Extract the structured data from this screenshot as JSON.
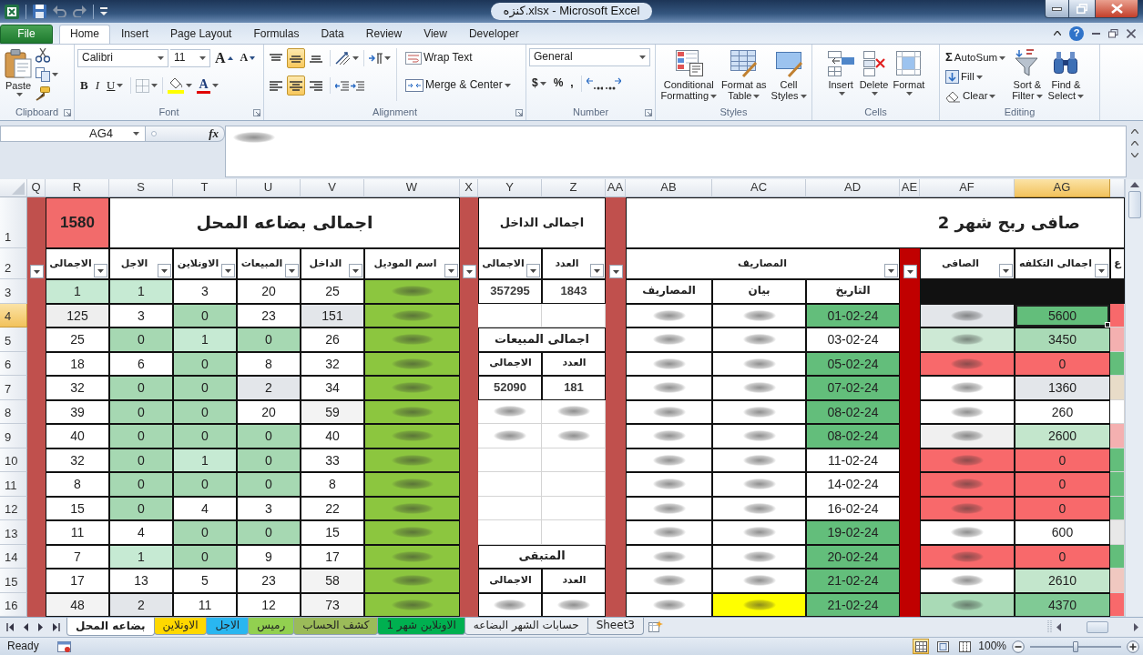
{
  "window": {
    "title": "كنزه.xlsx - Microsoft Excel"
  },
  "ribbon_tabs": [
    {
      "label": "Developer",
      "kind": "tab",
      "selected": false
    },
    {
      "label": "View",
      "kind": "tab",
      "selected": false
    },
    {
      "label": "Review",
      "kind": "tab",
      "selected": false
    },
    {
      "label": "Data",
      "kind": "tab",
      "selected": false
    },
    {
      "label": "Formulas",
      "kind": "tab",
      "selected": false
    },
    {
      "label": "Page Layout",
      "kind": "tab",
      "selected": false
    },
    {
      "label": "Insert",
      "kind": "tab",
      "selected": false
    },
    {
      "label": "Home",
      "kind": "tab",
      "selected": true
    },
    {
      "label": "File",
      "kind": "file",
      "selected": false
    }
  ],
  "help": "?",
  "ribbon": {
    "clipboard": {
      "label": "Clipboard",
      "paste": "Paste"
    },
    "font": {
      "label": "Font",
      "font_name": "Calibri",
      "font_size": "11",
      "grow": "A",
      "shrink": "A",
      "bold": "B",
      "italic": "I",
      "underline": "U",
      "font_color": "A"
    },
    "alignment": {
      "label": "Alignment",
      "vertical": [
        {
          "kind": "bottom",
          "selected": false
        },
        {
          "kind": "middle",
          "selected": true
        },
        {
          "kind": "top",
          "selected": false
        }
      ],
      "horizontal": [
        {
          "kind": "right",
          "selected": false
        },
        {
          "kind": "center",
          "selected": true
        },
        {
          "kind": "left",
          "selected": false
        }
      ],
      "wrap_text": "Wrap Text",
      "merge_center": "Merge & Center"
    },
    "number": {
      "label": "Number",
      "format": "General",
      "currency": "$",
      "percent": "%",
      "comma": ","
    },
    "styles": {
      "label": "Styles",
      "buttons": [
        {
          "kind": "cell_styles",
          "lines": [
            "Cell",
            "Styles"
          ]
        },
        {
          "kind": "table",
          "lines": [
            "Format as",
            "Table"
          ]
        },
        {
          "kind": "conditional",
          "lines": [
            "Conditional",
            "Formatting"
          ]
        }
      ]
    },
    "cells": {
      "label": "Cells",
      "buttons": [
        {
          "kind": "format",
          "label": "Format"
        },
        {
          "kind": "delete",
          "label": "Delete"
        },
        {
          "kind": "insert",
          "label": "Insert"
        }
      ]
    },
    "editing": {
      "label": "Editing",
      "small": [
        {
          "kind": "autosum",
          "symbol": "Σ",
          "label": "AutoSum"
        },
        {
          "kind": "fill",
          "label": "Fill"
        },
        {
          "kind": "clear",
          "label": "Clear"
        }
      ],
      "large": [
        {
          "kind": "find",
          "lines": [
            "Find &",
            "Select"
          ]
        },
        {
          "kind": "sort",
          "lines": [
            "Sort &",
            "Filter"
          ]
        }
      ]
    }
  },
  "formula_bar": {
    "name_box": "AG4",
    "fx": "fx",
    "formula_blurred": true
  },
  "sheet": {
    "columns": [
      {
        "label": "AG",
        "selected": true
      },
      {
        "label": "AF",
        "selected": false
      },
      {
        "label": "AE",
        "selected": false
      },
      {
        "label": "AD",
        "selected": false
      },
      {
        "label": "AC",
        "selected": false
      },
      {
        "label": "AB",
        "selected": false
      },
      {
        "label": "AA",
        "selected": false
      },
      {
        "label": "Z",
        "selected": false
      },
      {
        "label": "Y",
        "selected": false
      },
      {
        "label": "X",
        "selected": false
      },
      {
        "label": "W",
        "selected": false
      },
      {
        "label": "V",
        "selected": false
      },
      {
        "label": "U",
        "selected": false
      },
      {
        "label": "T",
        "selected": false
      },
      {
        "label": "S",
        "selected": false
      },
      {
        "label": "R",
        "selected": false
      },
      {
        "label": "Q",
        "selected": false
      }
    ],
    "rows": [
      {
        "label": "1",
        "selected": false
      },
      {
        "label": "2",
        "selected": false
      },
      {
        "label": "3",
        "selected": false
      },
      {
        "label": "4",
        "selected": true
      },
      {
        "label": "5",
        "selected": false
      },
      {
        "label": "6",
        "selected": false
      },
      {
        "label": "7",
        "selected": false
      },
      {
        "label": "8",
        "selected": false
      },
      {
        "label": "9",
        "selected": false
      },
      {
        "label": "10",
        "selected": false
      },
      {
        "label": "11",
        "selected": false
      },
      {
        "label": "12",
        "selected": false
      },
      {
        "label": "13",
        "selected": false
      },
      {
        "label": "14",
        "selected": false
      },
      {
        "label": "15",
        "selected": false
      },
      {
        "label": "16",
        "selected": false
      }
    ],
    "profit": {
      "title": "صافى ربح شهر 2",
      "cut_header": "ع",
      "cost_header": "اجمالى التكلفه",
      "net_header": "الصافى",
      "expenses_group": "المصاريف",
      "sub_headers": [
        "التاريخ",
        "بيان",
        "المصاريف"
      ],
      "rows": [
        {
          "edge": {
            "color": "#f8696b"
          },
          "cost": {
            "text": "5600",
            "color": "#63be7b"
          },
          "net": {
            "blurred": true,
            "color": "#e3e6ea"
          },
          "date": {
            "text": "01-02-24",
            "color": "#63be7b"
          },
          "note": {
            "blurred": true
          },
          "amount": {
            "blurred": true
          }
        },
        {
          "edge": {
            "color": "#f4b0b0"
          },
          "cost": {
            "text": "3450",
            "color": "#a9dab6"
          },
          "net": {
            "blurred": true,
            "color": "#cde9d5"
          },
          "date": {
            "text": "03-02-24"
          },
          "note": {
            "blurred": true
          },
          "amount": {
            "blurred": true
          }
        },
        {
          "edge": {
            "color": "#63be7b"
          },
          "cost": {
            "text": "0",
            "color": "#f8696b"
          },
          "net": {
            "blurred": true,
            "color": "#f8696b"
          },
          "date": {
            "text": "05-02-24",
            "color": "#63be7b"
          },
          "note": {
            "blurred": true
          },
          "amount": {
            "blurred": true
          }
        },
        {
          "edge": {
            "color": "#e8dcc8"
          },
          "cost": {
            "text": "1360",
            "color": "#e3e6ea"
          },
          "net": {
            "blurred": true
          },
          "date": {
            "text": "07-02-24",
            "color": "#63be7b"
          },
          "note": {
            "blurred": true
          },
          "amount": {
            "blurred": true
          }
        },
        {
          "cost": {
            "text": "260"
          },
          "net": {
            "blurred": true
          },
          "date": {
            "text": "08-02-24",
            "color": "#63be7b"
          },
          "note": {
            "blurred": true
          },
          "amount": {
            "blurred": true
          }
        },
        {
          "edge": {
            "color": "#f4b0b0"
          },
          "cost": {
            "text": "2600",
            "color": "#c3e6cc"
          },
          "net": {
            "blurred": true,
            "color": "#f0f0f0"
          },
          "date": {
            "text": "08-02-24",
            "color": "#63be7b"
          },
          "note": {
            "blurred": true
          },
          "amount": {
            "blurred": true
          }
        },
        {
          "edge": {
            "color": "#63be7b"
          },
          "cost": {
            "text": "0",
            "color": "#f8696b"
          },
          "net": {
            "blurred": true,
            "color": "#f8696b"
          },
          "date": {
            "text": "11-02-24"
          },
          "note": {
            "blurred": true
          },
          "amount": {
            "blurred": true
          }
        },
        {
          "edge": {
            "color": "#63be7b"
          },
          "cost": {
            "text": "0",
            "color": "#f8696b"
          },
          "net": {
            "blurred": true,
            "color": "#f8696b"
          },
          "date": {
            "text": "14-02-24"
          },
          "note": {
            "blurred": true
          },
          "amount": {
            "blurred": true
          }
        },
        {
          "edge": {
            "color": "#63be7b"
          },
          "cost": {
            "text": "0",
            "color": "#f8696b"
          },
          "net": {
            "blurred": true,
            "color": "#f8696b"
          },
          "date": {
            "text": "16-02-24"
          },
          "note": {
            "blurred": true
          },
          "amount": {
            "blurred": true
          }
        },
        {
          "edge": {
            "color": "#e8e8e8"
          },
          "cost": {
            "text": "600"
          },
          "net": {
            "blurred": true
          },
          "date": {
            "text": "19-02-24",
            "color": "#63be7b"
          },
          "note": {
            "blurred": true
          },
          "amount": {
            "blurred": true
          }
        },
        {
          "edge": {
            "color": "#63be7b"
          },
          "cost": {
            "text": "0",
            "color": "#f8696b"
          },
          "net": {
            "blurred": true,
            "color": "#f8696b"
          },
          "date": {
            "text": "20-02-24",
            "color": "#63be7b"
          },
          "note": {
            "blurred": true
          },
          "amount": {
            "blurred": true
          }
        },
        {
          "edge": {
            "color": "#f0c8c0"
          },
          "cost": {
            "text": "2610",
            "color": "#c3e6cc"
          },
          "net": {
            "blurred": true
          },
          "date": {
            "text": "21-02-24",
            "color": "#63be7b"
          },
          "note": {
            "blurred": true
          },
          "amount": {
            "blurred": true
          }
        },
        {
          "edge": {
            "color": "#f8696b"
          },
          "cost": {
            "text": "4370",
            "color": "#80ca95"
          },
          "net": {
            "blurred": true,
            "color": "#a9dab6"
          },
          "date": {
            "text": "21-02-24",
            "color": "#63be7b"
          },
          "note": {
            "blurred": true,
            "color": "#ffff00"
          },
          "amount": {
            "blurred": true
          }
        }
      ]
    },
    "income_total": {
      "title": "اجمالى الداخل",
      "headers": [
        "العدد",
        "الاجمالى"
      ],
      "values": [
        "1843",
        "357295"
      ]
    },
    "sales_total": {
      "title": "اجمالى المبيعات",
      "headers": [
        "العدد",
        "الاجمالى"
      ],
      "values": [
        "181",
        "52090"
      ],
      "detail_rows_blurred": true
    },
    "remaining": {
      "title": "المتبقى",
      "headers": [
        "العدد",
        "الاجمالى"
      ],
      "values_blurred": true
    },
    "inventory": {
      "title": "اجمالى بضاعه المحل",
      "total": "1580",
      "headers": [
        "اسم الموديل",
        "الداخل",
        "المبيعات",
        "الاونلاين",
        "الاجل",
        "الاجمالى"
      ],
      "rows": [
        {
          "name_blurred": true,
          "cells": [
            {
              "text": "25"
            },
            {
              "text": "20"
            },
            {
              "text": "3"
            },
            {
              "text": "1",
              "color": "#c6ead3"
            },
            {
              "text": "1",
              "color": "#c6ead3"
            }
          ]
        },
        {
          "name_blurred": true,
          "cells": [
            {
              "text": "151",
              "color": "#e3e6ea"
            },
            {
              "text": "23"
            },
            {
              "text": "0",
              "color": "#a6d8b2"
            },
            {
              "text": "3"
            },
            {
              "text": "125",
              "color": "#eeeeee"
            }
          ]
        },
        {
          "name_blurred": true,
          "cells": [
            {
              "text": "26"
            },
            {
              "text": "0",
              "color": "#a6d8b2"
            },
            {
              "text": "1",
              "color": "#c6ead3"
            },
            {
              "text": "0",
              "color": "#a6d8b2"
            },
            {
              "text": "25"
            }
          ]
        },
        {
          "name_blurred": true,
          "cells": [
            {
              "text": "32"
            },
            {
              "text": "8"
            },
            {
              "text": "0",
              "color": "#a6d8b2"
            },
            {
              "text": "6"
            },
            {
              "text": "18"
            }
          ]
        },
        {
          "name_blurred": true,
          "cells": [
            {
              "text": "34"
            },
            {
              "text": "2",
              "color": "#e3e6ea"
            },
            {
              "text": "0",
              "color": "#a6d8b2"
            },
            {
              "text": "0",
              "color": "#a6d8b2"
            },
            {
              "text": "32"
            }
          ]
        },
        {
          "name_blurred": true,
          "cells": [
            {
              "text": "59",
              "color": "#f3f3f3"
            },
            {
              "text": "20"
            },
            {
              "text": "0",
              "color": "#a6d8b2"
            },
            {
              "text": "0",
              "color": "#a6d8b2"
            },
            {
              "text": "39"
            }
          ]
        },
        {
          "name_blurred": true,
          "cells": [
            {
              "text": "40"
            },
            {
              "text": "0",
              "color": "#a6d8b2"
            },
            {
              "text": "0",
              "color": "#a6d8b2"
            },
            {
              "text": "0",
              "color": "#a6d8b2"
            },
            {
              "text": "40"
            }
          ]
        },
        {
          "name_blurred": true,
          "cells": [
            {
              "text": "33"
            },
            {
              "text": "0",
              "color": "#a6d8b2"
            },
            {
              "text": "1",
              "color": "#c6ead3"
            },
            {
              "text": "0",
              "color": "#a6d8b2"
            },
            {
              "text": "32"
            }
          ]
        },
        {
          "name_blurred": true,
          "cells": [
            {
              "text": "8"
            },
            {
              "text": "0",
              "color": "#a6d8b2"
            },
            {
              "text": "0",
              "color": "#a6d8b2"
            },
            {
              "text": "0",
              "color": "#a6d8b2"
            },
            {
              "text": "8"
            }
          ]
        },
        {
          "name_blurred": true,
          "cells": [
            {
              "text": "22"
            },
            {
              "text": "3"
            },
            {
              "text": "4"
            },
            {
              "text": "0",
              "color": "#a6d8b2"
            },
            {
              "text": "15"
            }
          ]
        },
        {
          "name_blurred": true,
          "cells": [
            {
              "text": "15"
            },
            {
              "text": "0",
              "color": "#a6d8b2"
            },
            {
              "text": "0",
              "color": "#a6d8b2"
            },
            {
              "text": "4"
            },
            {
              "text": "11"
            }
          ]
        },
        {
          "name_blurred": true,
          "cells": [
            {
              "text": "17"
            },
            {
              "text": "9"
            },
            {
              "text": "0",
              "color": "#a6d8b2"
            },
            {
              "text": "1",
              "color": "#c6ead3"
            },
            {
              "text": "7"
            }
          ]
        },
        {
          "name_blurred": true,
          "cells": [
            {
              "text": "58",
              "color": "#f3f3f3"
            },
            {
              "text": "23"
            },
            {
              "text": "5"
            },
            {
              "text": "13"
            },
            {
              "text": "17"
            }
          ]
        },
        {
          "name_blurred": true,
          "cells": [
            {
              "text": "73",
              "color": "#f3f3f3"
            },
            {
              "text": "12"
            },
            {
              "text": "11"
            },
            {
              "text": "2",
              "color": "#e3e6ea"
            },
            {
              "text": "48",
              "color": "#f3f3f3"
            }
          ]
        }
      ]
    }
  },
  "sheet_tabs": [
    {
      "label": "Sheet3",
      "selected": false
    },
    {
      "label": "حسابات الشهر البضاعه",
      "selected": false
    },
    {
      "label": "الاونلاين شهر 1",
      "selected": false,
      "color": "#00b050"
    },
    {
      "label": "كشف الحساب",
      "selected": false,
      "color": "#9bbb59"
    },
    {
      "label": "رميس",
      "selected": false,
      "color": "#92d050"
    },
    {
      "label": "الاجل",
      "selected": false,
      "color": "#29b6f0"
    },
    {
      "label": "الاونلاين",
      "selected": false,
      "color": "#ffd800"
    },
    {
      "label": "بضاعه المحل",
      "selected": true
    }
  ],
  "status_bar": {
    "zoom_slider": {
      "level": 0.5
    },
    "zoom": "100%",
    "views": [
      {
        "kind": "page_break",
        "selected": false
      },
      {
        "kind": "page_layout",
        "selected": false
      },
      {
        "kind": "normal",
        "selected": true
      }
    ],
    "status": "Ready"
  }
}
